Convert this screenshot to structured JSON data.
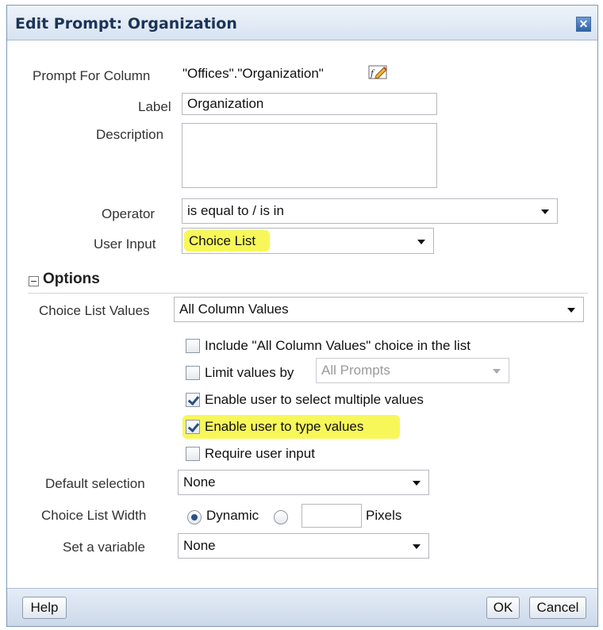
{
  "dialog": {
    "title": "Edit Prompt: Organization",
    "close_icon": "close-icon"
  },
  "form": {
    "prompt_for_column": {
      "label": "Prompt For Column",
      "value": "\"Offices\".\"Organization\"",
      "icon": "edit-formula-icon"
    },
    "label_field": {
      "label": "Label",
      "value": "Organization"
    },
    "description_field": {
      "label": "Description",
      "value": ""
    },
    "operator": {
      "label": "Operator",
      "value": "is equal to / is in"
    },
    "user_input": {
      "label": "User Input",
      "value": "Choice List"
    }
  },
  "options": {
    "title": "Options",
    "toggle_icon": "collapse-icon",
    "choice_list_values": {
      "label": "Choice List Values",
      "value": "All Column Values"
    },
    "checkboxes": [
      {
        "label": "Include \"All Column Values\" choice in the list",
        "checked": false
      },
      {
        "label": "Limit values by",
        "checked": false,
        "select_value": "All Prompts"
      },
      {
        "label": "Enable user to select multiple values",
        "checked": true
      },
      {
        "label": "Enable user to type values",
        "checked": true
      },
      {
        "label": "Require user input",
        "checked": false
      }
    ],
    "default_selection": {
      "label": "Default selection",
      "value": "None"
    },
    "choice_list_width": {
      "label": "Choice List Width",
      "dynamic_label": "Dynamic",
      "pixels_value": "",
      "pixels_label": "Pixels"
    },
    "set_variable": {
      "label": "Set a variable",
      "value": "None"
    }
  },
  "footer": {
    "help_label": "Help",
    "ok_label": "OK",
    "cancel_label": "Cancel"
  },
  "colors": {
    "highlight": "#f7f75a",
    "title_text": "#1b3457",
    "titlebar_bg": "#dbe6f3"
  }
}
